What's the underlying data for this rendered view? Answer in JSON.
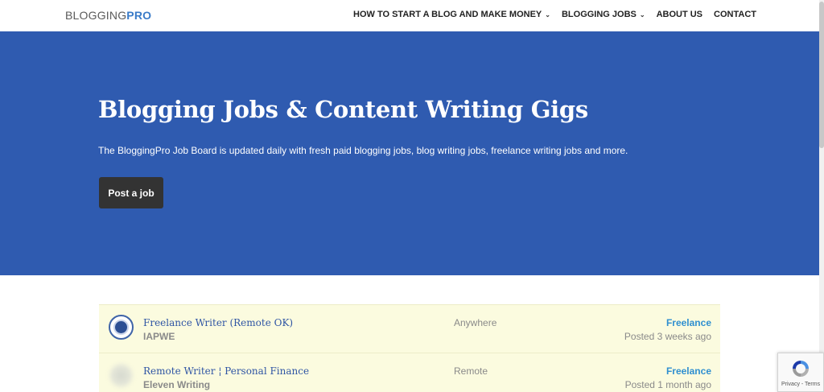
{
  "header": {
    "logo_part1": "BLOGGING",
    "logo_part2": "PRO",
    "nav": [
      {
        "label": "HOW TO START A BLOG AND MAKE MONEY",
        "has_dropdown": true
      },
      {
        "label": "BLOGGING JOBS",
        "has_dropdown": true
      },
      {
        "label": "ABOUT US",
        "has_dropdown": false
      },
      {
        "label": "CONTACT",
        "has_dropdown": false
      }
    ],
    "chevron": "⌄"
  },
  "hero": {
    "title": "Blogging Jobs & Content Writing Gigs",
    "subtitle": "The BloggingPro Job Board is updated daily with fresh paid blogging jobs, blog writing jobs, freelance writing jobs and more.",
    "button_label": "Post a job",
    "background_color": "#2f5bb0"
  },
  "jobs": [
    {
      "title": "Freelance Writer (Remote OK)",
      "company": "IAPWE",
      "location": "Anywhere",
      "type": "Freelance",
      "posted": "Posted 3 weeks ago",
      "logo_icon": "iapwe-seal-icon"
    },
    {
      "title": "Remote Writer ¦ Personal Finance",
      "company": "Eleven Writing",
      "location": "Remote",
      "type": "Freelance",
      "posted": "Posted 1 month ago",
      "logo_icon": "company-logo-icon"
    }
  ],
  "recaptcha": {
    "links": "Privacy - Terms"
  }
}
